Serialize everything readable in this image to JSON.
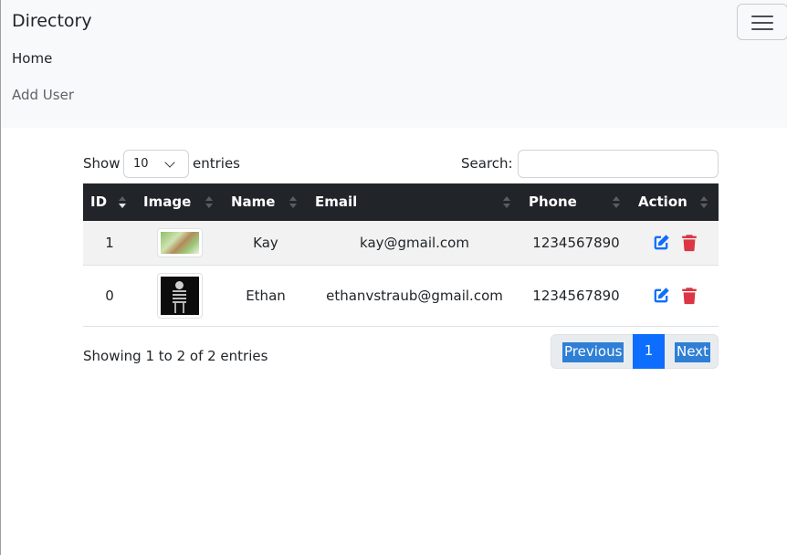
{
  "navbar": {
    "brand": "Directory",
    "links": [
      "Home",
      "Add User"
    ]
  },
  "controls": {
    "show_label": "Show",
    "entries_label": "entries",
    "page_length": "10",
    "search_label": "Search:",
    "search_value": ""
  },
  "table": {
    "headers": [
      "ID",
      "Image",
      "Name",
      "Email",
      "Phone",
      "Action"
    ],
    "rows": [
      {
        "id": "1",
        "name": "Kay",
        "email": "kay@gmail.com",
        "phone": "1234567890"
      },
      {
        "id": "0",
        "name": "Ethan",
        "email": "ethanvstraub@gmail.com",
        "phone": "1234567890"
      }
    ]
  },
  "footer": {
    "info": "Showing 1 to 2 of 2 entries",
    "previous": "Previous",
    "page": "1",
    "next": "Next"
  },
  "colors": {
    "header_bg": "#212529",
    "primary": "#0d6efd",
    "danger": "#dc3545",
    "navbar_bg": "#f8f9fa"
  }
}
